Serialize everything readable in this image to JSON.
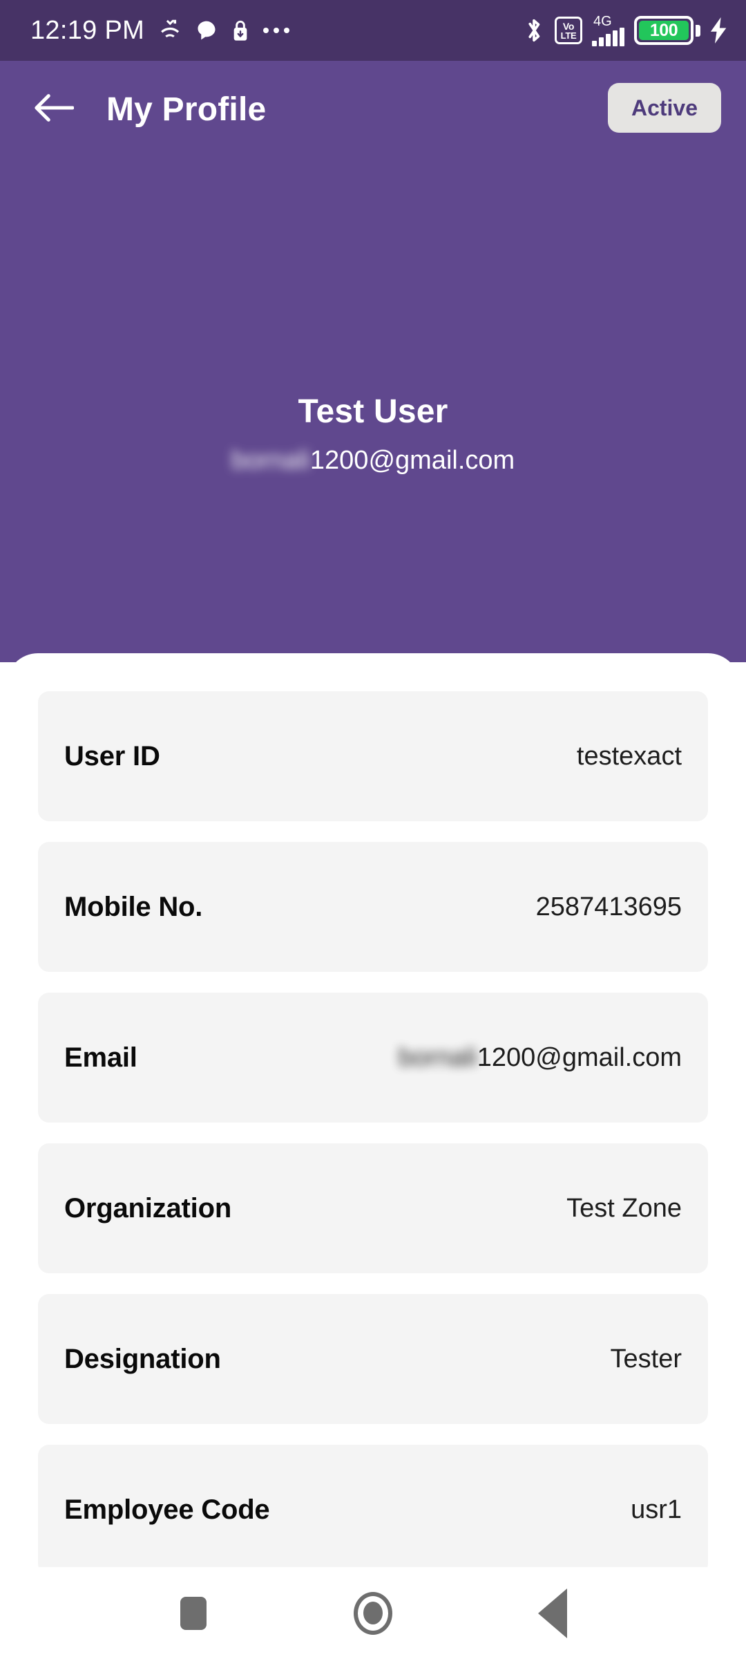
{
  "statusbar": {
    "time": "12:19 PM",
    "left_icons": [
      "missed-call-icon",
      "chat-bubble-icon",
      "lock-icon",
      "overflow-dots-icon"
    ],
    "right_icons": [
      "bluetooth-icon",
      "volte-icon",
      "network-4g-icon",
      "signal-bars-icon",
      "battery-icon",
      "charging-bolt-icon"
    ],
    "volte_top": "Vo",
    "volte_bottom": "LTE",
    "network_label": "4G",
    "battery_level": "100",
    "battery_color": "#22c65b"
  },
  "header": {
    "back_icon": "arrow-left-icon",
    "title": "My Profile",
    "status_label": "Active",
    "bg_color": "#60488E",
    "badge_bg": "#E5E4E2",
    "badge_text_color": "#4E3B7C"
  },
  "profile": {
    "name": "Test User",
    "email_masked": "bornali",
    "email_visible": "1200@gmail.com"
  },
  "details": {
    "rows": [
      {
        "label": "User ID",
        "value": "testexact",
        "masked": "",
        "visible": ""
      },
      {
        "label": "Mobile No.",
        "value": "2587413695",
        "masked": "",
        "visible": ""
      },
      {
        "label": "Email",
        "value": "",
        "masked": "bornali",
        "visible": "1200@gmail.com"
      },
      {
        "label": "Organization",
        "value": "Test Zone",
        "masked": "",
        "visible": ""
      },
      {
        "label": "Designation",
        "value": "Tester",
        "masked": "",
        "visible": ""
      },
      {
        "label": "Employee Code",
        "value": "usr1",
        "masked": "",
        "visible": ""
      }
    ]
  },
  "navbar": {
    "recents_icon": "square-recents-icon",
    "home_icon": "circle-home-icon",
    "back_icon": "triangle-back-icon"
  }
}
